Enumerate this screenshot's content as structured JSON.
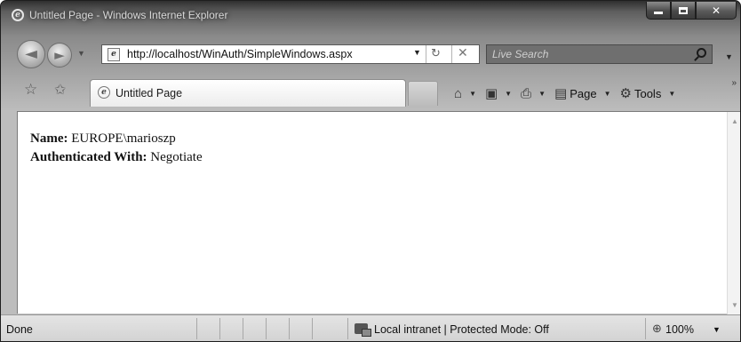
{
  "window": {
    "title": "Untitled Page - Windows Internet Explorer",
    "minimize_glyph": "",
    "close_glyph": "✕"
  },
  "nav": {
    "back_glyph": "◄",
    "forward_glyph": "►",
    "dropdown_glyph": "▼",
    "url": "http://localhost/WinAuth/SimpleWindows.aspx",
    "refresh_glyph": "↻",
    "stop_glyph": "✕",
    "search_placeholder": "Live Search"
  },
  "toolbar": {
    "favorites_glyph": "☆",
    "add_favorites_glyph": "✩",
    "tab_label": "Untitled Page",
    "home_glyph": "⌂",
    "feeds_glyph": "▣",
    "print_glyph": "⎙",
    "page_glyph": "▤",
    "page_label": "Page",
    "tools_glyph": "⚙",
    "tools_label": "Tools",
    "arrow_glyph": "▼",
    "chevron_glyph": "»"
  },
  "page": {
    "name_label": "Name:",
    "name_value": "EUROPE\\marioszp",
    "auth_label": "Authenticated With:",
    "auth_value": "Negotiate"
  },
  "status": {
    "text": "Done",
    "zone": "Local intranet | Protected Mode: Off",
    "zoom_glyph": "⊕",
    "zoom": "100%",
    "zoom_arrow": "▼"
  },
  "icons": {
    "ie_icon": "ie-logo-icon",
    "search_icon": "search-icon",
    "home_icon": "home-icon",
    "feeds_icon": "rss-feed-icon",
    "print_icon": "printer-icon",
    "tools_icon": "gear-icon",
    "zone_icon": "network-zone-icon"
  },
  "colors": {
    "frame_dark": "#2f2f2f",
    "frame_light": "#bdbdbd",
    "content_bg": "#ffffff",
    "status_bg": "#d8d8d8"
  }
}
